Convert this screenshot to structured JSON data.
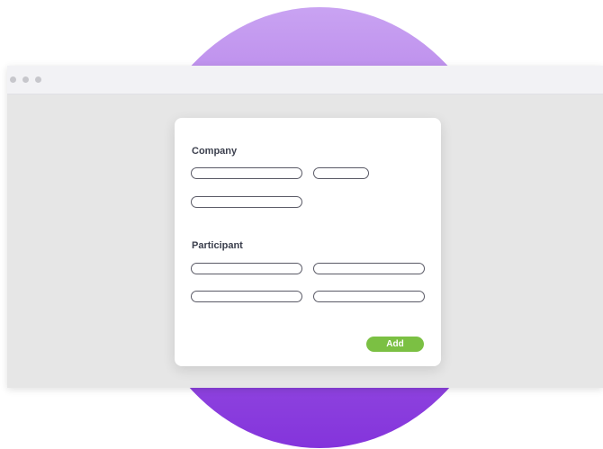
{
  "titlebar": {
    "dots": [
      "window-dot",
      "window-dot",
      "window-dot"
    ]
  },
  "form": {
    "company": {
      "title": "Company",
      "fields": [
        {
          "value": "",
          "placeholder": ""
        },
        {
          "value": "",
          "placeholder": ""
        },
        {
          "value": "",
          "placeholder": ""
        }
      ]
    },
    "participant": {
      "title": "Participant",
      "fields": [
        {
          "value": "",
          "placeholder": ""
        },
        {
          "value": "",
          "placeholder": ""
        },
        {
          "value": "",
          "placeholder": ""
        },
        {
          "value": "",
          "placeholder": ""
        }
      ]
    },
    "add_label": "Add"
  },
  "colors": {
    "accent_purple_top": "#c9a3f2",
    "accent_purple_bottom": "#8434dc",
    "button_green": "#7bc043",
    "window_bg": "#e6e6e6",
    "titlebar_bg": "#f2f2f5",
    "text_dark": "#3b3f4d"
  }
}
